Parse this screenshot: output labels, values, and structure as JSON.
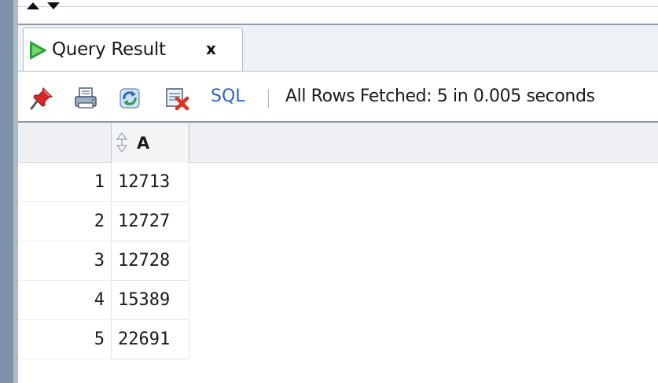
{
  "panel": {
    "tab_label": "Query Result",
    "tab_close": "x"
  },
  "toolbar": {
    "icons": [
      "pin-icon",
      "print-icon",
      "refresh-icon",
      "clear-icon"
    ],
    "sql_label": "SQL",
    "status": "All Rows Fetched: 5 in 0.005 seconds"
  },
  "grid": {
    "columns": [
      "A"
    ],
    "rows": [
      {
        "num": "1",
        "a": "12713"
      },
      {
        "num": "2",
        "a": "12727"
      },
      {
        "num": "3",
        "a": "12728"
      },
      {
        "num": "4",
        "a": "15389"
      },
      {
        "num": "5",
        "a": "22691"
      }
    ]
  },
  "colors": {
    "accent": "#2b63c6",
    "play": "#27a23a",
    "frame": "#7d92ad"
  }
}
